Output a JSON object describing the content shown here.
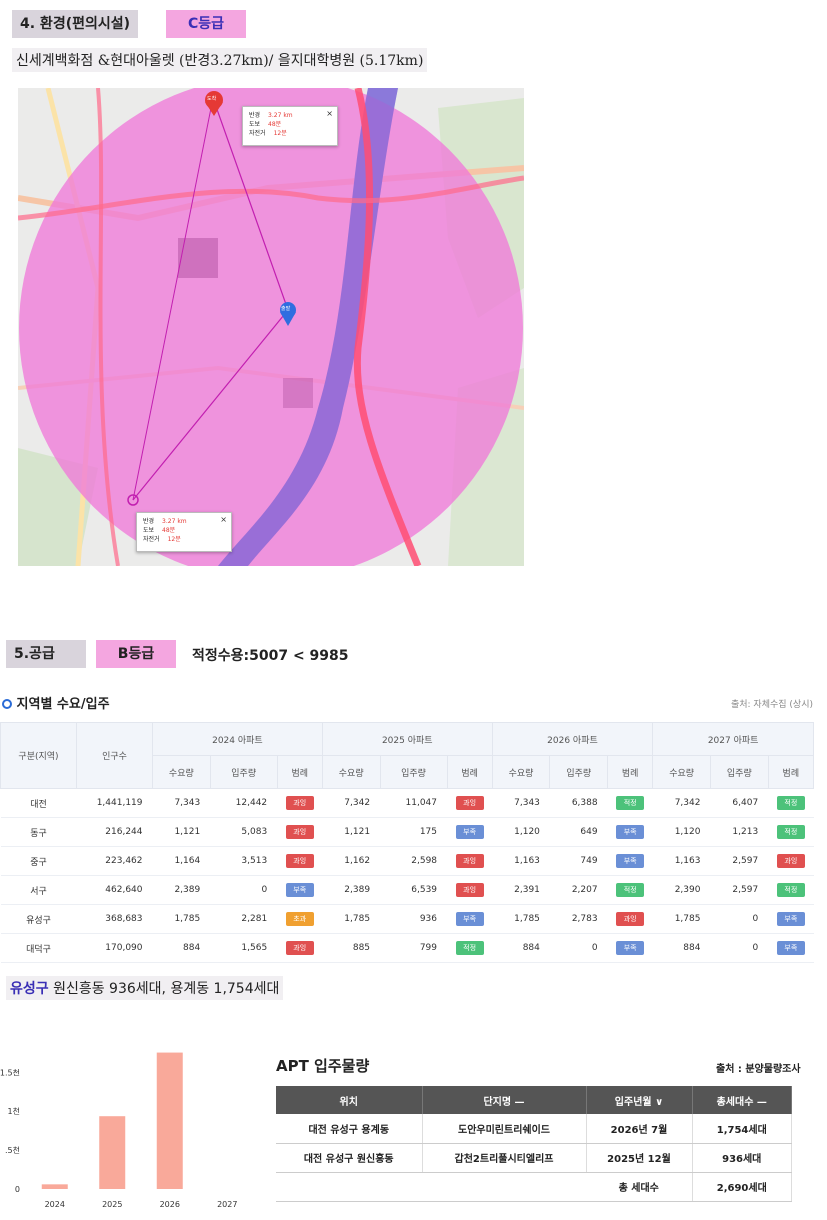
{
  "section4": {
    "label": "4. 환경(편의시설)",
    "grade": "C등급",
    "desc": "신세계백화점 &현대아울렛 (반경3.27km)/ 을지대학병원 (5.17km)"
  },
  "map": {
    "popup_top": {
      "radius_label": "반경",
      "radius_value": "3.27 km",
      "walk_label": "도보",
      "walk_value": "48분",
      "bike_label": "자전거",
      "bike_value": "12분",
      "close": "×"
    },
    "popup_bottom": {
      "radius_label": "반경",
      "radius_value": "3.27 km",
      "walk_label": "도보",
      "walk_value": "48분",
      "bike_label": "자전거",
      "bike_value": "12분",
      "close": "×"
    },
    "center_marker": "출발",
    "top_marker": "도착",
    "circle_color": "#f07ad8"
  },
  "section5": {
    "label": "5.공급",
    "grade": "B등급",
    "note": "적정수용:5007 < 9985"
  },
  "supply_table": {
    "title": "지역별 수요/입주",
    "source": "출처: 자체수집 (상시)",
    "col_region": "구분(지역)",
    "col_population": "인구수",
    "years": [
      "2024 아파트",
      "2025 아파트",
      "2026 아파트",
      "2027 아파트"
    ],
    "sub_headers": [
      "수요량",
      "입주량",
      "범례"
    ],
    "rows": [
      {
        "region": "대전",
        "population": "1,441,119",
        "cells": [
          [
            "7,343",
            "12,442",
            "과잉"
          ],
          [
            "7,342",
            "11,047",
            "과잉"
          ],
          [
            "7,343",
            "6,388",
            "적정"
          ],
          [
            "7,342",
            "6,407",
            "적정"
          ]
        ]
      },
      {
        "region": "동구",
        "population": "216,244",
        "cells": [
          [
            "1,121",
            "5,083",
            "과잉"
          ],
          [
            "1,121",
            "175",
            "부족"
          ],
          [
            "1,120",
            "649",
            "부족"
          ],
          [
            "1,120",
            "1,213",
            "적정"
          ]
        ]
      },
      {
        "region": "중구",
        "population": "223,462",
        "cells": [
          [
            "1,164",
            "3,513",
            "과잉"
          ],
          [
            "1,162",
            "2,598",
            "과잉"
          ],
          [
            "1,163",
            "749",
            "부족"
          ],
          [
            "1,163",
            "2,597",
            "과잉"
          ]
        ]
      },
      {
        "region": "서구",
        "population": "462,640",
        "cells": [
          [
            "2,389",
            "0",
            "부족"
          ],
          [
            "2,389",
            "6,539",
            "과잉"
          ],
          [
            "2,391",
            "2,207",
            "적정"
          ],
          [
            "2,390",
            "2,597",
            "적정"
          ]
        ]
      },
      {
        "region": "유성구",
        "population": "368,683",
        "cells": [
          [
            "1,785",
            "2,281",
            "초과"
          ],
          [
            "1,785",
            "936",
            "부족"
          ],
          [
            "1,785",
            "2,783",
            "과잉"
          ],
          [
            "1,785",
            "0",
            "부족"
          ]
        ]
      },
      {
        "region": "대덕구",
        "population": "170,090",
        "cells": [
          [
            "884",
            "1,565",
            "과잉"
          ],
          [
            "885",
            "799",
            "적정"
          ],
          [
            "884",
            "0",
            "부족"
          ],
          [
            "884",
            "0",
            "부족"
          ]
        ]
      }
    ],
    "badge_colors": {
      "과잉": "#e05050",
      "부족": "#6a8fd6",
      "적정": "#4cc27a",
      "초과": "#f0a030"
    }
  },
  "yuseong": {
    "district": "유성구",
    "detail": " 원신흥동 936세대, 용계동 1,754세대"
  },
  "chart_data": {
    "type": "bar",
    "categories": [
      "2024",
      "2025",
      "2026",
      "2027"
    ],
    "values": [
      60,
      936,
      1754,
      0
    ],
    "yticks": [
      "0",
      ".5천",
      "1천",
      "1.5천"
    ],
    "ytick_values": [
      0,
      500,
      1000,
      1500
    ],
    "ylim": [
      0,
      1800
    ],
    "bar_color": "#f9a99a"
  },
  "apt_table": {
    "title": "APT 입주물량",
    "source": "출처 : 분양물량조사",
    "headers": [
      "위치",
      "단지명 —",
      "입주년월 ∨",
      "총세대수 —"
    ],
    "rows": [
      [
        "대전 유성구 용계동",
        "도안우미린트리쉐이드",
        "2026년 7월",
        "1,754세대"
      ],
      [
        "대전 유성구 원신흥동",
        "갑천2트리풀시티엘리프",
        "2025년 12월",
        "936세대"
      ]
    ],
    "total_label": "총 세대수",
    "total_value": "2,690세대"
  }
}
